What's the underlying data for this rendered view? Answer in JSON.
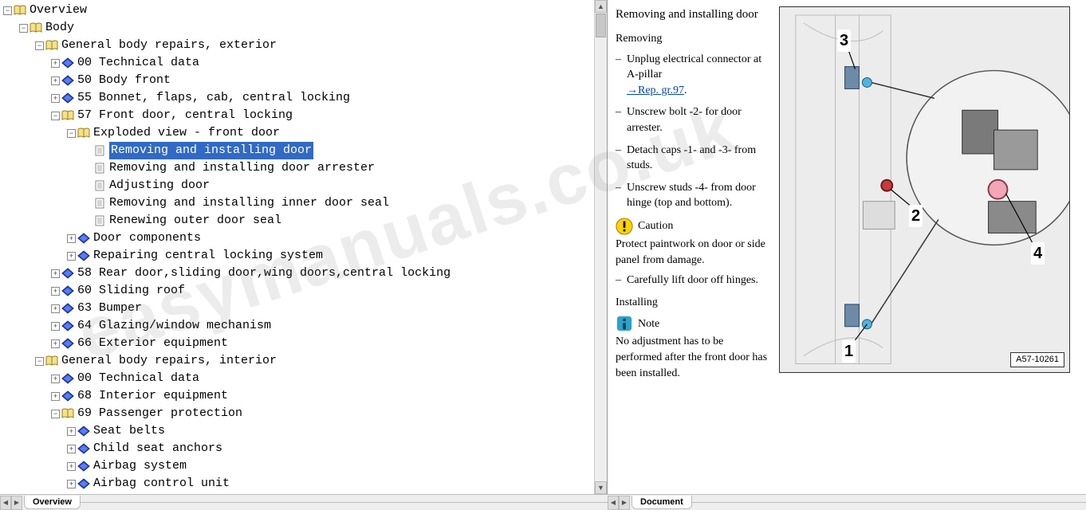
{
  "watermark": "easymanuals.co.uk",
  "bottom_tabs": {
    "left": "Overview",
    "right": "Document"
  },
  "tree": [
    {
      "depth": 0,
      "toggle": "-",
      "icon": "book",
      "label": "Overview"
    },
    {
      "depth": 1,
      "toggle": "-",
      "icon": "book",
      "label": "Body"
    },
    {
      "depth": 2,
      "toggle": "-",
      "icon": "book",
      "label": "General body repairs, exterior"
    },
    {
      "depth": 3,
      "toggle": "+",
      "icon": "rhomb",
      "label": "00 Technical data"
    },
    {
      "depth": 3,
      "toggle": "+",
      "icon": "rhomb",
      "label": "50 Body front"
    },
    {
      "depth": 3,
      "toggle": "+",
      "icon": "rhomb",
      "label": "55 Bonnet, flaps, cab, central locking"
    },
    {
      "depth": 3,
      "toggle": "-",
      "icon": "book",
      "label": "57 Front door, central locking"
    },
    {
      "depth": 4,
      "toggle": "-",
      "icon": "book",
      "label": "Exploded view - front door"
    },
    {
      "depth": 5,
      "toggle": " ",
      "icon": "page",
      "label": "Removing and installing door",
      "selected": true
    },
    {
      "depth": 5,
      "toggle": " ",
      "icon": "page",
      "label": "Removing and installing door arrester"
    },
    {
      "depth": 5,
      "toggle": " ",
      "icon": "page",
      "label": "Adjusting door"
    },
    {
      "depth": 5,
      "toggle": " ",
      "icon": "page",
      "label": "Removing and installing inner door seal"
    },
    {
      "depth": 5,
      "toggle": " ",
      "icon": "page",
      "label": "Renewing outer door seal"
    },
    {
      "depth": 4,
      "toggle": "+",
      "icon": "rhomb",
      "label": "Door components"
    },
    {
      "depth": 4,
      "toggle": "+",
      "icon": "rhomb",
      "label": "Repairing central locking system"
    },
    {
      "depth": 3,
      "toggle": "+",
      "icon": "rhomb",
      "label": "58 Rear door,sliding door,wing doors,central locking"
    },
    {
      "depth": 3,
      "toggle": "+",
      "icon": "rhomb",
      "label": "60 Sliding roof"
    },
    {
      "depth": 3,
      "toggle": "+",
      "icon": "rhomb",
      "label": "63 Bumper"
    },
    {
      "depth": 3,
      "toggle": "+",
      "icon": "rhomb",
      "label": "64 Glazing/window mechanism"
    },
    {
      "depth": 3,
      "toggle": "+",
      "icon": "rhomb",
      "label": "66 Exterior equipment"
    },
    {
      "depth": 2,
      "toggle": "-",
      "icon": "book",
      "label": "General body repairs, interior"
    },
    {
      "depth": 3,
      "toggle": "+",
      "icon": "rhomb",
      "label": "00 Technical data"
    },
    {
      "depth": 3,
      "toggle": "+",
      "icon": "rhomb",
      "label": "68 Interior equipment"
    },
    {
      "depth": 3,
      "toggle": "-",
      "icon": "book",
      "label": "69 Passenger protection"
    },
    {
      "depth": 4,
      "toggle": "+",
      "icon": "rhomb",
      "label": "Seat belts"
    },
    {
      "depth": 4,
      "toggle": "+",
      "icon": "rhomb",
      "label": "Child seat anchors"
    },
    {
      "depth": 4,
      "toggle": "+",
      "icon": "rhomb",
      "label": "Airbag system"
    },
    {
      "depth": 4,
      "toggle": "+",
      "icon": "rhomb",
      "label": "Airbag control unit"
    }
  ],
  "doc": {
    "title": "Removing and installing door",
    "h_removing": "Removing",
    "steps_removing": [
      {
        "text": "Unplug electrical connector at A-pillar",
        "link": "→Rep. gr.97"
      },
      {
        "text": "Unscrew bolt -2- for door arrester."
      },
      {
        "text": "Detach caps -1- and -3- from studs."
      },
      {
        "text": "Unscrew studs -4- from door hinge (top and bottom)."
      }
    ],
    "caution_label": "Caution",
    "caution_text": "Protect paintwork on door or side panel from damage.",
    "step_lift": "Carefully lift door off hinges.",
    "h_installing": "Installing",
    "note_label": "Note",
    "note_text": "No adjustment has to be performed after the front door has been installed.",
    "diagram_id": "A57-10261",
    "callouts": [
      "1",
      "2",
      "3",
      "4"
    ]
  }
}
